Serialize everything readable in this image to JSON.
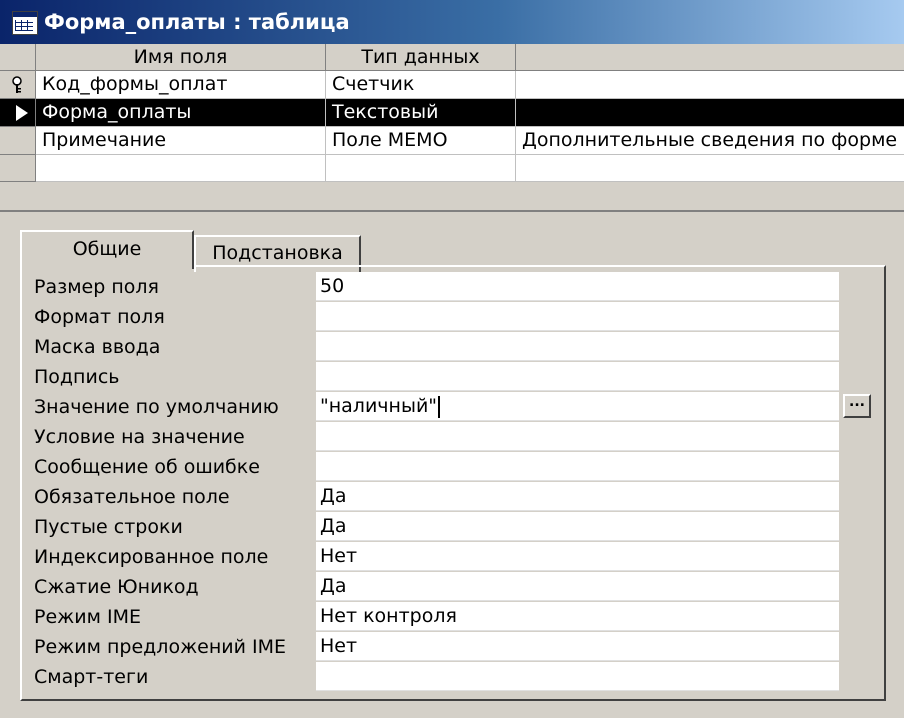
{
  "window": {
    "title": "Форма_оплаты : таблица",
    "icon": "table-icon"
  },
  "grid": {
    "columns": [
      "Имя поля",
      "Тип данных",
      ""
    ],
    "rows": [
      {
        "name": "Код_формы_оплат",
        "type": "Счетчик",
        "description": "",
        "marker": "key-icon"
      },
      {
        "name": "Форма_оплаты",
        "type": "Текстовый",
        "description": "",
        "marker": "current-row-arrow-icon"
      },
      {
        "name": "Примечание",
        "type": "Поле MEMO",
        "description": "Дополнительные сведения по форме",
        "marker": ""
      },
      {
        "name": "",
        "type": "",
        "description": "",
        "marker": ""
      }
    ]
  },
  "tabs": {
    "general": "Общие",
    "lookup": "Подстановка"
  },
  "properties": [
    {
      "label": "Размер поля",
      "value": "50"
    },
    {
      "label": "Формат поля",
      "value": ""
    },
    {
      "label": "Маска ввода",
      "value": ""
    },
    {
      "label": "Подпись",
      "value": ""
    },
    {
      "label": "Значение по умолчанию",
      "value": "\"наличный\""
    },
    {
      "label": "Условие на значение",
      "value": ""
    },
    {
      "label": "Сообщение об ошибке",
      "value": ""
    },
    {
      "label": "Обязательное поле",
      "value": "Да"
    },
    {
      "label": "Пустые строки",
      "value": "Да"
    },
    {
      "label": "Индексированное поле",
      "value": "Нет"
    },
    {
      "label": "Сжатие Юникод",
      "value": "Да"
    },
    {
      "label": "Режим IME",
      "value": "Нет контроля"
    },
    {
      "label": "Режим предложений IME",
      "value": "Нет"
    },
    {
      "label": "Смарт-теги",
      "value": ""
    }
  ],
  "build_button": {
    "label": "..."
  },
  "colors": {
    "title_start": "#0a246a",
    "title_end": "#a6caf0",
    "face": "#d4d0c8",
    "selection": "#000000"
  }
}
